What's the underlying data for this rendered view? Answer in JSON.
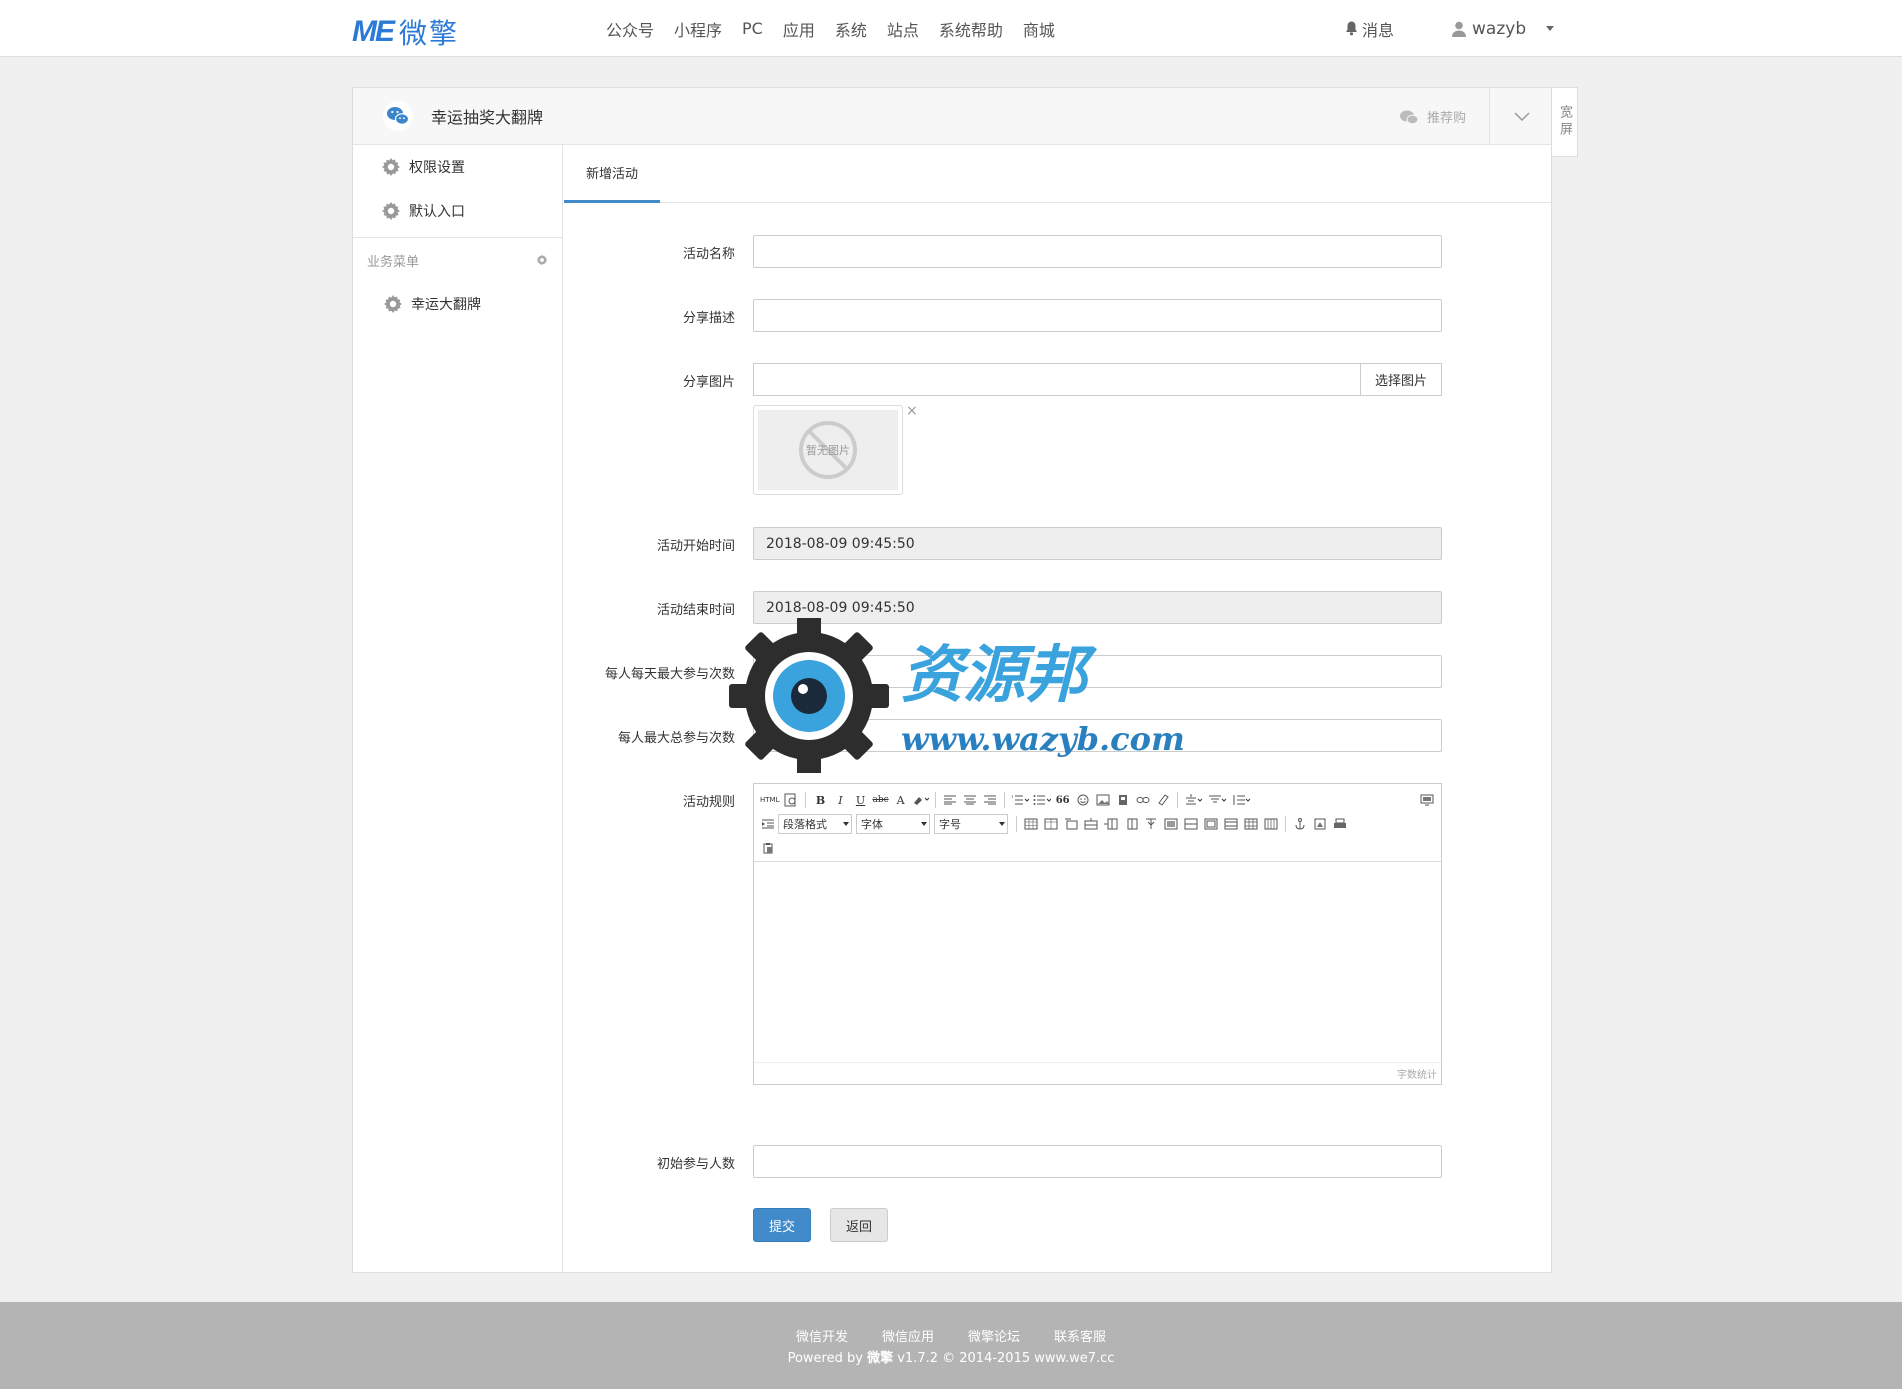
{
  "header": {
    "logo_mark": "ME",
    "logo_text": "微擎",
    "nav": [
      "公众号",
      "小程序",
      "PC",
      "应用",
      "系统",
      "站点",
      "系统帮助",
      "商城"
    ],
    "messages_label": "消息",
    "username": "wazyb"
  },
  "panel": {
    "app_title": "幸运抽奖大翻牌",
    "recommend_label": "推荐购",
    "wide_label": "宽屏"
  },
  "sidebar": {
    "items": [
      {
        "label": "权限设置"
      },
      {
        "label": "默认入口"
      }
    ],
    "group_title": "业务菜单",
    "group_items": [
      {
        "label": "幸运大翻牌"
      }
    ]
  },
  "tabs": [
    {
      "label": "新增活动"
    }
  ],
  "form": {
    "name_label": "活动名称",
    "name_value": "",
    "desc_label": "分享描述",
    "desc_value": "",
    "image_label": "分享图片",
    "image_value": "",
    "image_button": "选择图片",
    "image_placeholder": "暂无图片",
    "image_close": "×",
    "start_label": "活动开始时间",
    "start_value": "2018-08-09 09:45:50",
    "end_label": "活动结束时间",
    "end_value": "2018-08-09 09:45:50",
    "daily_label": "每人每天最大参与次数",
    "daily_value": "",
    "total_label": "每人最大总参与次数",
    "total_value": "",
    "rules_label": "活动规则",
    "initial_label": "初始参与人数",
    "initial_value": "",
    "submit": "提交",
    "back": "返回"
  },
  "editor": {
    "html_btn": "HTML",
    "bold": "B",
    "italic": "I",
    "underline": "U",
    "strike": "abc",
    "fontcolor": "A",
    "quote": "66",
    "paragraph": "段落格式",
    "font": "字体",
    "size": "字号",
    "word_count": "字数统计"
  },
  "watermark": {
    "title": "资源邦",
    "url": "www.wazyb.com"
  },
  "footer": {
    "links": [
      "微信开发",
      "微信应用",
      "微擎论坛",
      "联系客服"
    ],
    "powered": "Powered by",
    "brand": "微擎",
    "version": "v1.7.2 © 2014-2015 www.we7.cc"
  },
  "colors": {
    "accent": "#428bca",
    "logo": "#2b7ad6",
    "footer_bg": "#b4b4b4"
  }
}
